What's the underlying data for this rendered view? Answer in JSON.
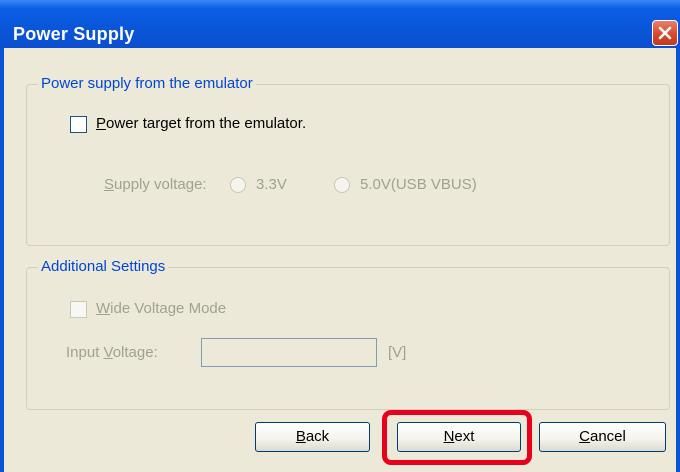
{
  "window": {
    "title": "Power Supply",
    "close_icon": "close-icon"
  },
  "group_power": {
    "label": "Power supply from the emulator",
    "checkbox_label": "Power target from the emulator.",
    "checkbox_checked": false,
    "supply_voltage_label": "Supply voltage:",
    "options": [
      {
        "label": "3.3V",
        "selected": false,
        "enabled": false
      },
      {
        "label": "5.0V(USB VBUS)",
        "selected": false,
        "enabled": false
      }
    ]
  },
  "group_additional": {
    "label": "Additional Settings",
    "checkbox_label": "Wide Voltage Mode",
    "checkbox_checked": false,
    "checkbox_enabled": false,
    "input_voltage_label": "Input Voltage:",
    "input_voltage_value": "",
    "unit": "[V]"
  },
  "buttons": {
    "back": "Back",
    "next": "Next",
    "cancel": "Cancel"
  },
  "colors": {
    "titlebar": "#0a55d8",
    "group_label": "#0046d5",
    "highlight": "#e8001c",
    "dialog_bg": "#ece9d8"
  }
}
